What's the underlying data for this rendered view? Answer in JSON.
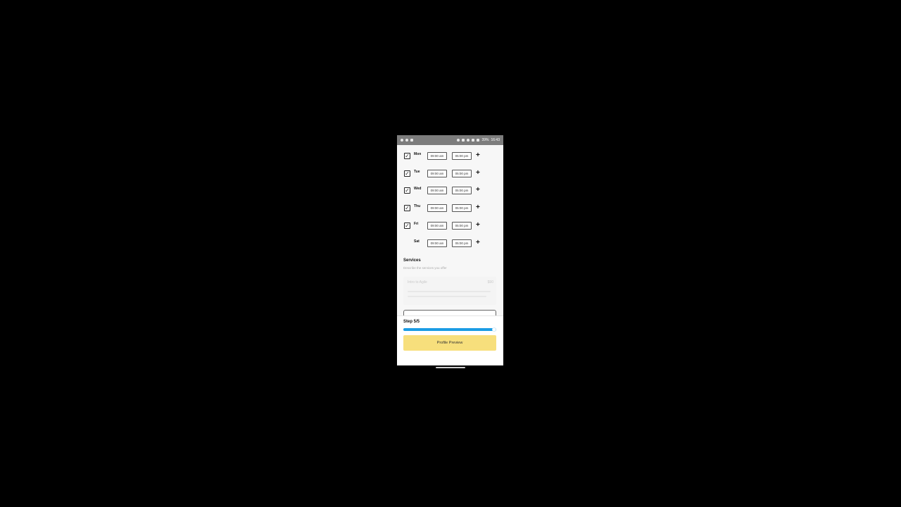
{
  "status_bar": {
    "left_icons": [
      "notification-icon",
      "sync-icon",
      "photo-icon"
    ],
    "right_icons": [
      "alarm-icon",
      "bluetooth-icon",
      "minus-icon",
      "wifi-icon",
      "signal-icon"
    ],
    "battery": "39%",
    "time": "16:43"
  },
  "schedule": {
    "days": [
      {
        "label": "Mon",
        "checked": true,
        "open": "09:00 am",
        "close": "05:00 pm"
      },
      {
        "label": "Tue",
        "checked": true,
        "open": "09:00 am",
        "close": "05:00 pm"
      },
      {
        "label": "Wed",
        "checked": true,
        "open": "09:00 am",
        "close": "05:00 pm"
      },
      {
        "label": "Thu",
        "checked": true,
        "open": "09:00 am",
        "close": "05:00 pm"
      },
      {
        "label": "Fri",
        "checked": true,
        "open": "09:00 am",
        "close": "05:00 pm"
      },
      {
        "label": "Sat",
        "checked": false,
        "open": "09:00 am",
        "close": "05:00 pm"
      }
    ],
    "add_symbol": "+",
    "check_symbol": "✓"
  },
  "services": {
    "title": "Services",
    "description": "Describe the services you offer",
    "card": {
      "name": "Intro to Agile",
      "price": "$90"
    }
  },
  "footer": {
    "step_label": "Step 5/5",
    "progress": 1.0,
    "progress_color": "#1b9ce4",
    "button_label": "Profile Preview",
    "button_color": "#f7df7c"
  }
}
